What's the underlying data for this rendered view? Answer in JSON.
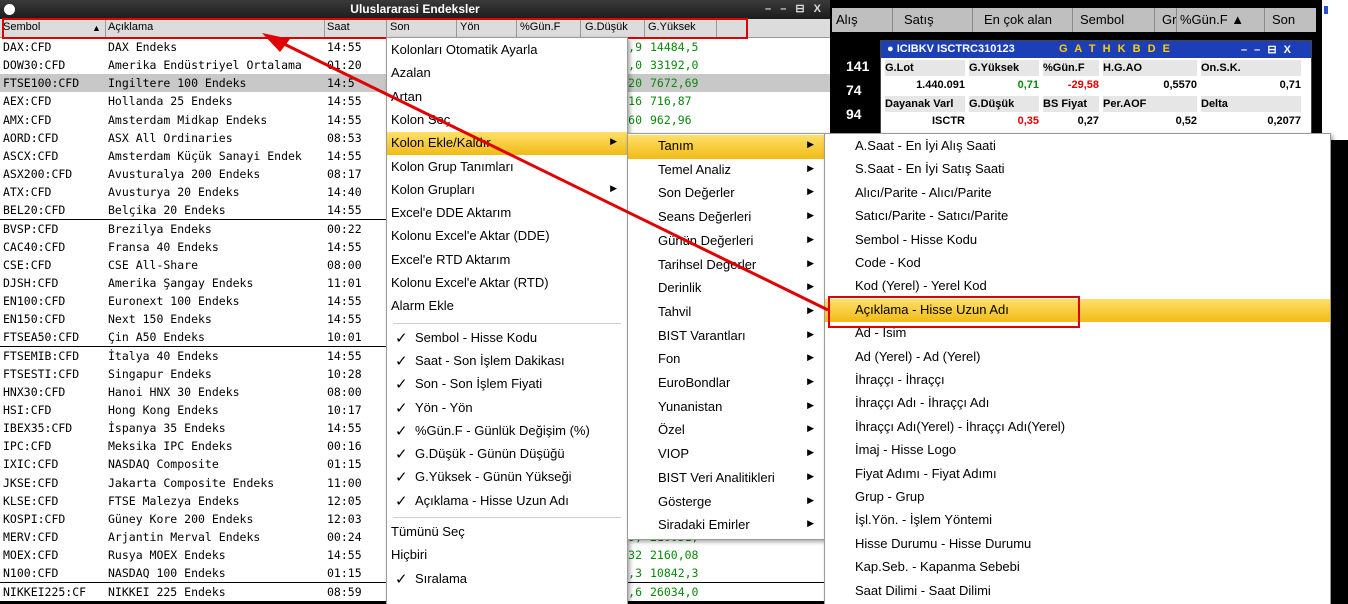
{
  "grid_window": {
    "title": "Uluslararasi Endeksler",
    "window_controls": "– – ⊟ X",
    "columns": [
      "Sembol",
      "Açıklama",
      "Saat",
      "Son",
      "Yön",
      "%Gün.F",
      "G.Düşük",
      "G.Yüksek"
    ],
    "sort_indicator": "▲",
    "rows": [
      {
        "sym": "DAX:CFD",
        "desc": "DAX Endeks",
        "saat": "14:55",
        "pct": "3,9",
        "yuksek": "14484,5"
      },
      {
        "sym": "DOW30:CFD",
        "desc": "Amerika Endüstriyel Ortalama",
        "saat": "01:20",
        "pct": "2,0",
        "yuksek": "33192,0"
      },
      {
        "sym": "FTSE100:CFD",
        "desc": "Ingiltere 100 Endeks",
        "saat": "14:5",
        "pct": "20",
        "yuksek": "7672,69"
      },
      {
        "sym": "AEX:CFD",
        "desc": "Hollanda 25 Endeks",
        "saat": "14:55",
        "pct": "16",
        "yuksek": "716,87"
      },
      {
        "sym": "AMX:CFD",
        "desc": "Amsterdam Midkap Endeks",
        "saat": "14:55",
        "pct": "60",
        "yuksek": "962,96"
      },
      {
        "sym": "AORD:CFD",
        "desc": "ASX All Ordinaries",
        "saat": "08:53",
        "pct": "",
        "yuksek": ""
      },
      {
        "sym": "ASCX:CFD",
        "desc": "Amsterdam Küçük Sanayi Endek",
        "saat": "14:55",
        "pct": "",
        "yuksek": ""
      },
      {
        "sym": "ASX200:CFD",
        "desc": "Avusturalya 200 Endeks",
        "saat": "08:17",
        "pct": "",
        "yuksek": ""
      },
      {
        "sym": "ATX:CFD",
        "desc": "Avusturya 20 Endeks",
        "saat": "14:40",
        "pct": "",
        "yuksek": ""
      },
      {
        "sym": "BEL20:CFD",
        "desc": "Belçika 20 Endeks",
        "saat": "14:55",
        "pct": "",
        "yuksek": ""
      },
      {
        "sym": "BVSP:CFD",
        "desc": "Brezilya Endeks",
        "saat": "00:22",
        "pct": "",
        "yuksek": ""
      },
      {
        "sym": "CAC40:CFD",
        "desc": "Fransa 40 Endeks",
        "saat": "14:55",
        "pct": "",
        "yuksek": ""
      },
      {
        "sym": "CSE:CFD",
        "desc": "CSE All-Share",
        "saat": "08:00",
        "pct": "",
        "yuksek": ""
      },
      {
        "sym": "DJSH:CFD",
        "desc": "Amerika Şangay Endeks",
        "saat": "11:01",
        "pct": "",
        "yuksek": ""
      },
      {
        "sym": "EN100:CFD",
        "desc": "Euronext 100 Endeks",
        "saat": "14:55",
        "pct": "",
        "yuksek": ""
      },
      {
        "sym": "EN150:CFD",
        "desc": "Next 150 Endeks",
        "saat": "14:55",
        "pct": "",
        "yuksek": ""
      },
      {
        "sym": "FTSEA50:CFD",
        "desc": "Çin A50 Endeks",
        "saat": "10:01",
        "pct": "",
        "yuksek": ""
      },
      {
        "sym": "FTSEMIB:CFD",
        "desc": "İtalya 40 Endeks",
        "saat": "14:55",
        "pct": "",
        "yuksek": ""
      },
      {
        "sym": "FTSESTI:CFD",
        "desc": "Singapur Endeks",
        "saat": "10:28",
        "pct": "",
        "yuksek": ""
      },
      {
        "sym": "HNX30:CFD",
        "desc": "Hanoi HNX 30 Endeks",
        "saat": "08:00",
        "pct": "",
        "yuksek": ""
      },
      {
        "sym": "HSI:CFD",
        "desc": "Hong Kong Endeks",
        "saat": "10:17",
        "pct": "",
        "yuksek": ""
      },
      {
        "sym": "IBEX35:CFD",
        "desc": "İspanya 35 Endeks",
        "saat": "14:55",
        "pct": "",
        "yuksek": ""
      },
      {
        "sym": "IPC:CFD",
        "desc": "Meksika IPC Endeks",
        "saat": "00:16",
        "pct": "",
        "yuksek": ""
      },
      {
        "sym": "IXIC:CFD",
        "desc": "NASDAQ Composite",
        "saat": "01:15",
        "pct": "",
        "yuksek": ""
      },
      {
        "sym": "JKSE:CFD",
        "desc": "Jakarta Composite Endeks",
        "saat": "11:00",
        "pct": "",
        "yuksek": ""
      },
      {
        "sym": "KLSE:CFD",
        "desc": "FTSE Malezya Endeks",
        "saat": "12:05",
        "pct": "",
        "yuksek": ""
      },
      {
        "sym": "KOSPI:CFD",
        "desc": "Güney Kore 200 Endeks",
        "saat": "12:03",
        "pct": "",
        "yuksek": ""
      },
      {
        "sym": "MERV:CFD",
        "desc": "Arjantin Merval Endeks",
        "saat": "00:24",
        "pct": "79,",
        "yuksek": "210051,"
      },
      {
        "sym": "MOEX:CFD",
        "desc": "Rusya MOEX Endeks",
        "saat": "14:55",
        "pct": "32",
        "yuksek": "2160,08"
      },
      {
        "sym": "N100:CFD",
        "desc": "NASDAQ 100 Endeks",
        "saat": "01:15",
        "pct": "3,3",
        "yuksek": "10842,3"
      },
      {
        "sym": "NIKKEI225:CF",
        "desc": "NIKKEI 225 Endeks",
        "saat": "08:59",
        "pct": "9,6",
        "yuksek": "26034,0"
      }
    ]
  },
  "right_window": {
    "columns": [
      "Alış",
      "Satış",
      "En çok alan",
      "Sembol",
      "Gr",
      "%Gün.F ▲",
      "Son"
    ],
    "side_numbers": [
      "141",
      "74",
      "94"
    ],
    "inner": {
      "title": "● ICIBKV ISCTRC310123",
      "title_letters": "G A T H K B D E",
      "title_controls": "– – ⊟ X",
      "labels_row1": [
        "G.Lot",
        "G.Yüksek",
        "%Gün.F",
        "H.G.AO",
        "On.S.K."
      ],
      "values_row1": [
        "1.440.091",
        "0,71",
        "-29,58",
        "0,5570",
        "0,71"
      ],
      "labels_row2": [
        "Dayanak Varl",
        "G.Düşük",
        "BS Fiyat",
        "Per.AOF",
        "Delta"
      ],
      "values_row2": [
        "ISCTR",
        "0,35",
        "0,27",
        "0,52",
        "0,2077"
      ]
    }
  },
  "menu1": {
    "items": [
      "Kolonları Otomatik Ayarla",
      "Azalan",
      "Artan",
      "Kolon Seç",
      "Kolon Ekle/Kaldır",
      "Kolon Grup Tanımları",
      "Kolon Grupları",
      "Excel'e DDE Aktarım",
      "Kolonu Excel'e Aktar (DDE)",
      "Excel'e RTD Aktarım",
      "Kolonu Excel'e Aktar (RTD)",
      "Alarm Ekle",
      "Sembol - Hisse Kodu",
      "Saat - Son İşlem Dakikası",
      "Son - Son İşlem Fiyati",
      "Yön - Yön",
      "%Gün.F - Günlük Değişim (%)",
      "G.Düşük - Günün Düşüğü",
      "G.Yüksek - Günün Yükseği",
      "Açıklama - Hisse Uzun Adı",
      "Tümünü Seç",
      "Hiçbiri",
      "Sıralama"
    ],
    "check": "✓",
    "arrow": "▶"
  },
  "menu2": {
    "items": [
      "Tanım",
      "Temel Analiz",
      "Son Değerler",
      "Seans Değerleri",
      "Günün Değerleri",
      "Tarihsel Değerler",
      "Derinlik",
      "Tahvil",
      "BIST Varantları",
      "Fon",
      "EuroBondlar",
      "Yunanistan",
      "Özel",
      "VIOP",
      "BIST Veri Analitikleri",
      "Gösterge",
      "Siradaki Emirler"
    ]
  },
  "menu3": {
    "items": [
      "A.Saat - En İyi Alış Saati",
      "S.Saat - En İyi Satış Saati",
      "Alıcı/Parite - Alıcı/Parite",
      "Satıcı/Parite - Satıcı/Parite",
      "Sembol - Hisse Kodu",
      "Code - Kod",
      "Kod (Yerel) - Yerel Kod",
      "Açıklama - Hisse Uzun Adı",
      "Ad - İsim",
      "Ad (Yerel) - Ad (Yerel)",
      "İhraççı - İhraççı",
      "İhraççı Adı - İhraççı Adı",
      "İhraççı Adı(Yerel) - İhraççı Adı(Yerel)",
      "İmaj - Hisse Logo",
      "Fiyat Adımı - Fiyat Adımı",
      "Grup - Grup",
      "İşl.Yön. - İşlem Yöntemi",
      "Hisse Durumu - Hisse Durumu",
      "Kap.Seb. - Kapanma Sebebi",
      "Saat Dilimi - Saat Dilimi"
    ]
  },
  "colors": {
    "highlight": "#f1bb16",
    "annotation_red": "#e00000",
    "positive": "#0a8a0a",
    "negative": "#e00000"
  }
}
